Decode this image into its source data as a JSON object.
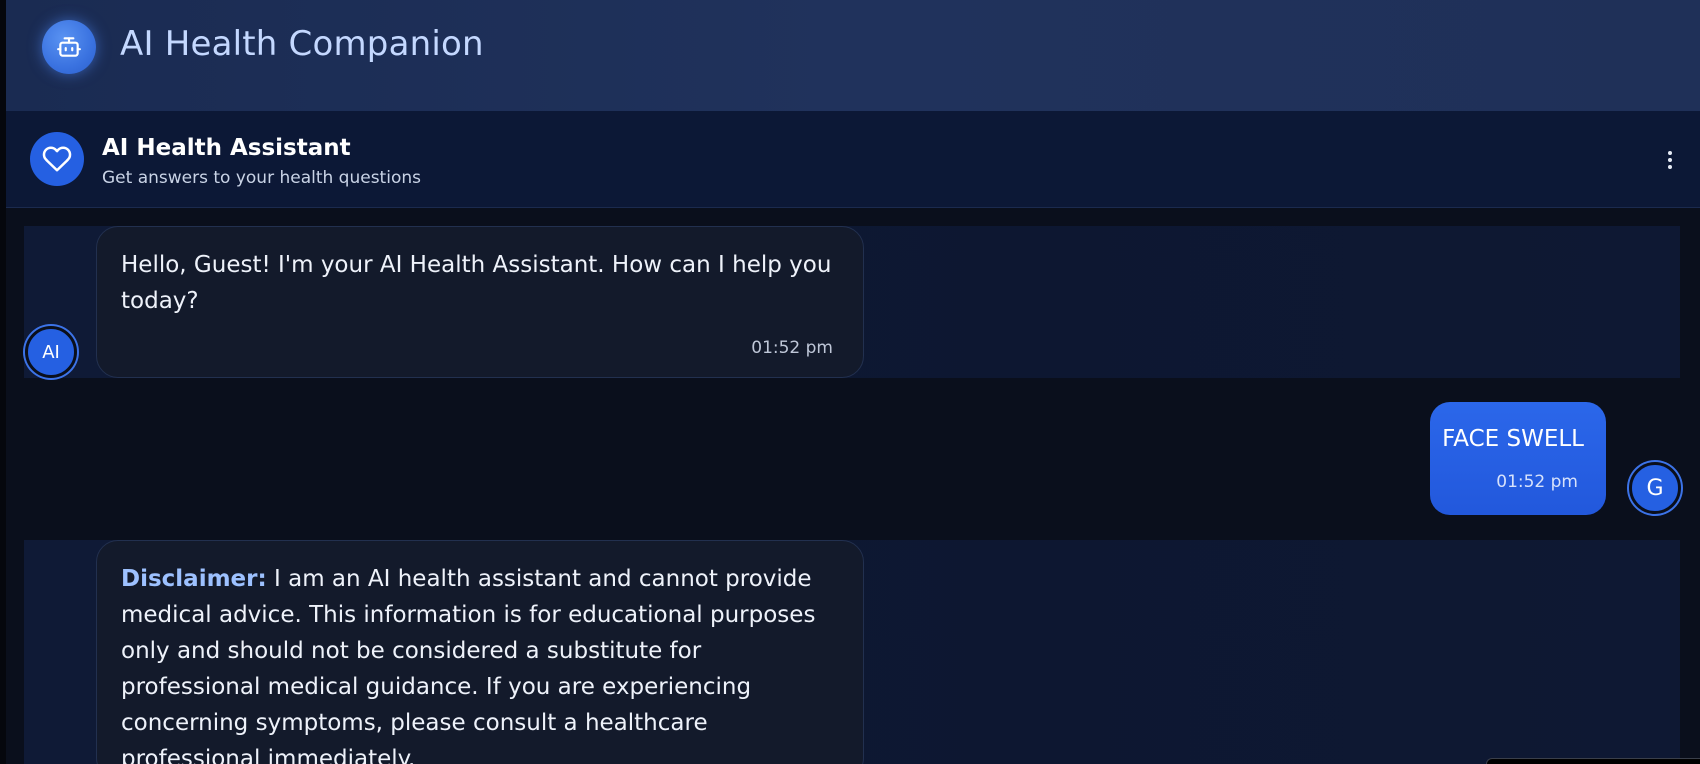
{
  "app": {
    "title": "AI Health Companion",
    "logo_icon": "robot-icon"
  },
  "chat_header": {
    "name": "AI Health Assistant",
    "subtitle": "Get answers to your health questions",
    "badge_icon": "heart-icon",
    "menu_icon": "more-vertical-icon"
  },
  "messages": [
    {
      "sender": "ai",
      "avatar": "AI",
      "text": "Hello, Guest! I'm your AI Health Assistant. How can I help you today?",
      "time": "01:52 pm"
    },
    {
      "sender": "user",
      "avatar": "G",
      "text": "FACE SWELL",
      "time": "01:52 pm"
    },
    {
      "sender": "ai",
      "label": "Disclaimer:",
      "text": " I am an AI health assistant and cannot provide medical advice. This information is for educational purposes only and should not be considered a substitute for professional medical guidance. If you are experiencing concerning symptoms, please consult a healthcare professional immediately."
    }
  ],
  "colors": {
    "accent": "#2560e2",
    "header_bg": "#1f3058",
    "chat_header_bg": "#0c1836",
    "page_bg": "#0a0f1c",
    "label": "#9dc1ff"
  }
}
